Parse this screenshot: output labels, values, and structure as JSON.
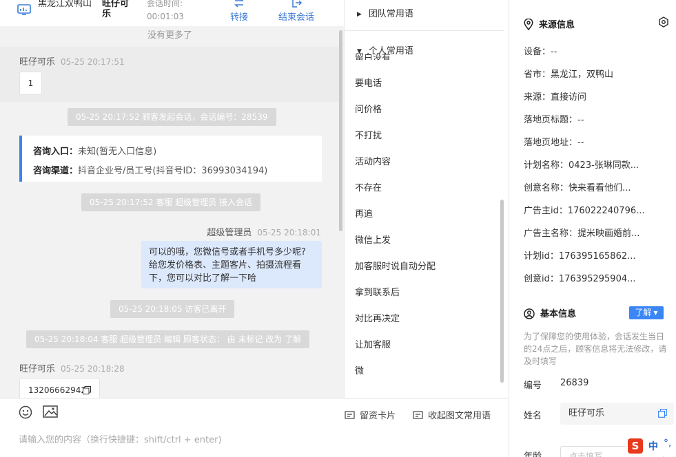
{
  "header": {
    "location": "黑龙江双鸭山",
    "visitor_name": "旺仔可乐",
    "duration_label": "会话时间:",
    "duration": "00:01:03",
    "transfer_label": "转接",
    "end_label": "结束会话"
  },
  "chat": {
    "no_more": "没有更多了",
    "msg1": {
      "sender": "旺仔可乐",
      "time": "05-25 20:17:51",
      "text": "1"
    },
    "sys_start": "05-25 20:17:52 顾客发起会话，会话编号：28539",
    "info_card": {
      "entry_label": "咨询入口：",
      "entry_value": "未知(暂无入口信息)",
      "channel_label": "咨询渠道：",
      "channel_value": "抖音企业号/员工号(抖音号ID：36993034194)"
    },
    "sys_join": "05-25 20:17:52 客服 超级管理员 接入会话",
    "agent_msg": {
      "sender": "超级管理员",
      "time": "05-25 20:18:01",
      "text": "可以的哦，您微信号或者手机号多少呢?给您发价格表、主题客片、拍摄流程看下，您可以对比了解一下哈"
    },
    "sys_left": "05-25 20:18:05 访客已离开",
    "sys_edit": "05-25 20:18:04 客服 超级管理员 编辑 顾客状态：  由 未标记 改为 了解",
    "msg2": {
      "sender": "旺仔可乐",
      "time": "05-25 20:18:28",
      "text": "13206662942"
    }
  },
  "composer": {
    "placeholder": "请输入您的内容（换行快捷键：shift/ctrl + enter)",
    "card_btn": "留资卡片",
    "phrase_btn": "收起图文常用语",
    "icons": [
      "emoji-icon",
      "image-icon",
      "card-icon",
      "phrase-icon"
    ]
  },
  "phrases": {
    "team_group": "团队常用语",
    "personal_group": "个人常用语",
    "cut_item": "留白没有",
    "items": [
      "要电话",
      "问价格",
      "不打扰",
      "活动内容",
      "不存在",
      "再追",
      "微信上发",
      "加客服时说自动分配",
      "拿到联系后",
      "对比再决定",
      "让加客服",
      "微"
    ]
  },
  "source": {
    "title": "来源信息",
    "rows": [
      "设备：--",
      "省市：黑龙江，双鸭山",
      "来源：直接访问",
      "落地页标题：--",
      "落地页地址：--",
      "计划名称：0423-张琳同款...",
      "创意名称：快来看看他们...",
      "广告主id：176022240796...",
      "广告主名称：提米映画婚前...",
      "计划id：176395165862...",
      "创意id：176395295904..."
    ]
  },
  "basic": {
    "title": "基本信息",
    "tag": "了解",
    "notice": "为了保障您的使用体验，会话发生当日的24点之后，顾客信息将无法修改，请及时填写",
    "id_label": "编号",
    "id_value": "26839",
    "name_label": "姓名",
    "name_value": "旺仔可乐",
    "age_label": "年龄",
    "age_placeholder": "点击填写"
  },
  "ime": {
    "logo": "S",
    "lang": "中",
    "punct": "°,"
  },
  "colors": {
    "accent": "#3a86f5",
    "agent_bubble": "#dce8fc",
    "system_pill": "#d9d9d9"
  }
}
